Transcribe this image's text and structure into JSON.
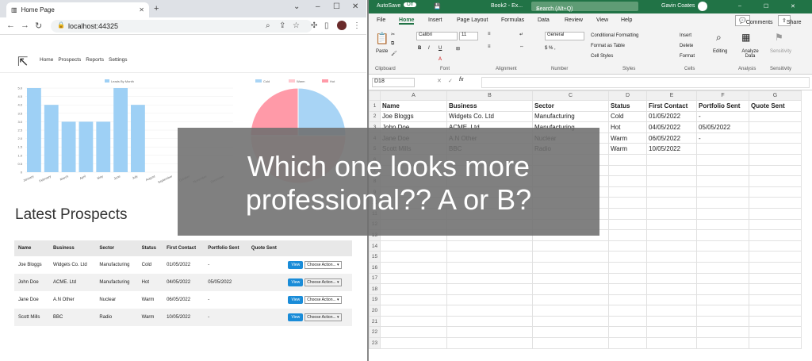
{
  "browser": {
    "tab_title": "Home Page",
    "url": "localhost:44325",
    "nav": [
      "Home",
      "Prospects",
      "Reports",
      "Settings"
    ]
  },
  "bar_chart": {
    "chart_data": {
      "type": "bar",
      "title": "",
      "legend": "Leads By Month",
      "categories": [
        "January",
        "February",
        "March",
        "April",
        "May",
        "June",
        "July",
        "August",
        "September",
        "October",
        "November",
        "December"
      ],
      "values": [
        5,
        4,
        3,
        3,
        3,
        5,
        4,
        0,
        0,
        0,
        0,
        0
      ],
      "ylim": [
        0,
        5
      ],
      "yticks": [
        "0",
        "0.5",
        "1.0",
        "1.5",
        "2.0",
        "2.5",
        "3.0",
        "3.5",
        "4.0",
        "4.5",
        "5.0"
      ]
    }
  },
  "pie_chart": {
    "chart_data": {
      "type": "pie",
      "categories": [
        "Cold",
        "Warm",
        "Hot"
      ],
      "values": [
        1,
        2,
        1
      ],
      "colors": [
        "#a8d4f5",
        "#ffc8cf",
        "#ff9aa8"
      ]
    }
  },
  "page_heading": "Latest Prospects",
  "prospects": {
    "headers": [
      "Name",
      "Business",
      "Sector",
      "Status",
      "First Contact",
      "Portfolio Sent",
      "Quote Sent"
    ],
    "rows": [
      [
        "Joe Bloggs",
        "Widgets Co. Ltd",
        "Manufacturing",
        "Cold",
        "01/05/2022",
        "-",
        ""
      ],
      [
        "John Doe",
        "ACME. Ltd",
        "Manufacturing",
        "Hot",
        "04/05/2022",
        "05/05/2022",
        ""
      ],
      [
        "Jane Doe",
        "A.N Other",
        "Nuclear",
        "Warm",
        "06/05/2022",
        "-",
        ""
      ],
      [
        "Scott Mills",
        "BBC",
        "Radio",
        "Warm",
        "10/05/2022",
        "-",
        ""
      ]
    ],
    "view_label": "View",
    "action_label": "Choose Action..."
  },
  "excel": {
    "autosave": "AutoSave",
    "autosave_state": "Off",
    "book": "Book2 - Ex...",
    "search": "Search (Alt+Q)",
    "user": "Gavin Coates",
    "menus": [
      "File",
      "Home",
      "Insert",
      "Page Layout",
      "Formulas",
      "Data",
      "Review",
      "View",
      "Help"
    ],
    "comments": "Comments",
    "share": "Share",
    "font_name": "Calibri",
    "font_size": "11",
    "number_format": "General",
    "ribbon": {
      "cond": "Conditional Formatting",
      "table": "Format as Table",
      "cell": "Cell Styles",
      "insert": "Insert",
      "delete": "Delete",
      "format": "Format",
      "editing": "Editing",
      "analyze": "Analyze Data",
      "sensitivity": "Sensitivity",
      "groups": [
        "Clipboard",
        "Font",
        "Alignment",
        "Number",
        "Styles",
        "Cells",
        "Analysis",
        "Sensitivity"
      ]
    },
    "name_box": "D18",
    "columns": [
      "A",
      "B",
      "C",
      "D",
      "E",
      "F",
      "G"
    ],
    "cells": [
      [
        "Name",
        "Business",
        "Sector",
        "Status",
        "First Contact",
        "Portfolio Sent",
        "Quote Sent"
      ],
      [
        "Joe Bloggs",
        "Widgets Co. Ltd",
        "Manufacturing",
        "Cold",
        "01/05/2022",
        "-",
        ""
      ],
      [
        "John Doe",
        "ACME. Ltd",
        "Manufacturing",
        "Hot",
        "04/05/2022",
        "05/05/2022",
        ""
      ],
      [
        "Jane Doe",
        "A.N Other",
        "Nuclear",
        "Warm",
        "06/05/2022",
        "-",
        ""
      ],
      [
        "Scott Mills",
        "BBC",
        "Radio",
        "Warm",
        "10/05/2022",
        "",
        ""
      ]
    ]
  },
  "overlay_text": "Which one looks more professional?? A or B?"
}
